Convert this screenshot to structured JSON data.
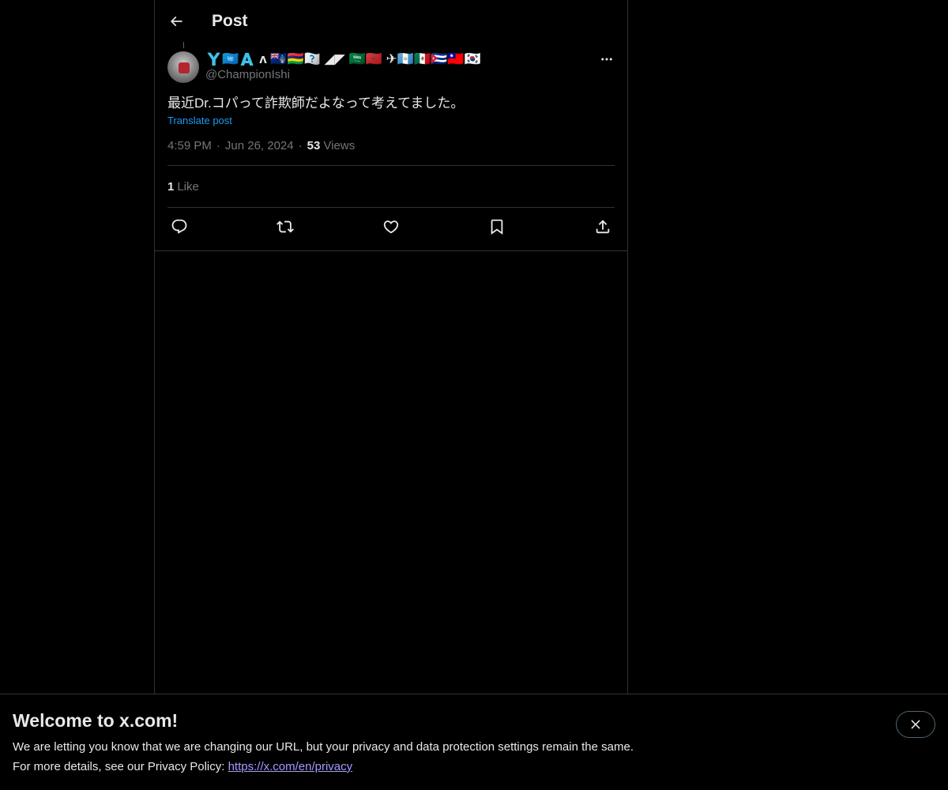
{
  "header": {
    "title": "Post"
  },
  "tweet": {
    "display_name": "🇾🇺🇳🇦 ʌ 🇹🇦🇲🇺🇷🇦 ◢◤ 🇸🇦🇲🇦 ✈🇬🇹🇲🇽🇨🇺🇹🇼🇰🇷",
    "handle": "@ChampionIshi",
    "text": "最近Dr.コパって詐欺師だよなって考えてました。",
    "translate_label": "Translate post",
    "time": "4:59 PM",
    "date": "Jun 26, 2024",
    "views_count": "53",
    "views_label": "Views",
    "likes_count": "1",
    "likes_label": "Like"
  },
  "banner": {
    "title": "Welcome to x.com!",
    "line1": "We are letting you know that we are changing our URL, but your privacy and data protection settings remain the same.",
    "line2_prefix": "For more details, see our Privacy Policy: ",
    "link": "https://x.com/en/privacy"
  },
  "colors": {
    "background": "#000000",
    "text_primary": "#e7e9ea",
    "text_secondary": "#71767b",
    "accent": "#1d9bf0",
    "border": "#2f3336"
  },
  "icons": [
    "back-arrow-icon",
    "more-icon",
    "reply-icon",
    "retweet-icon",
    "like-icon",
    "bookmark-icon",
    "share-icon",
    "close-icon"
  ]
}
